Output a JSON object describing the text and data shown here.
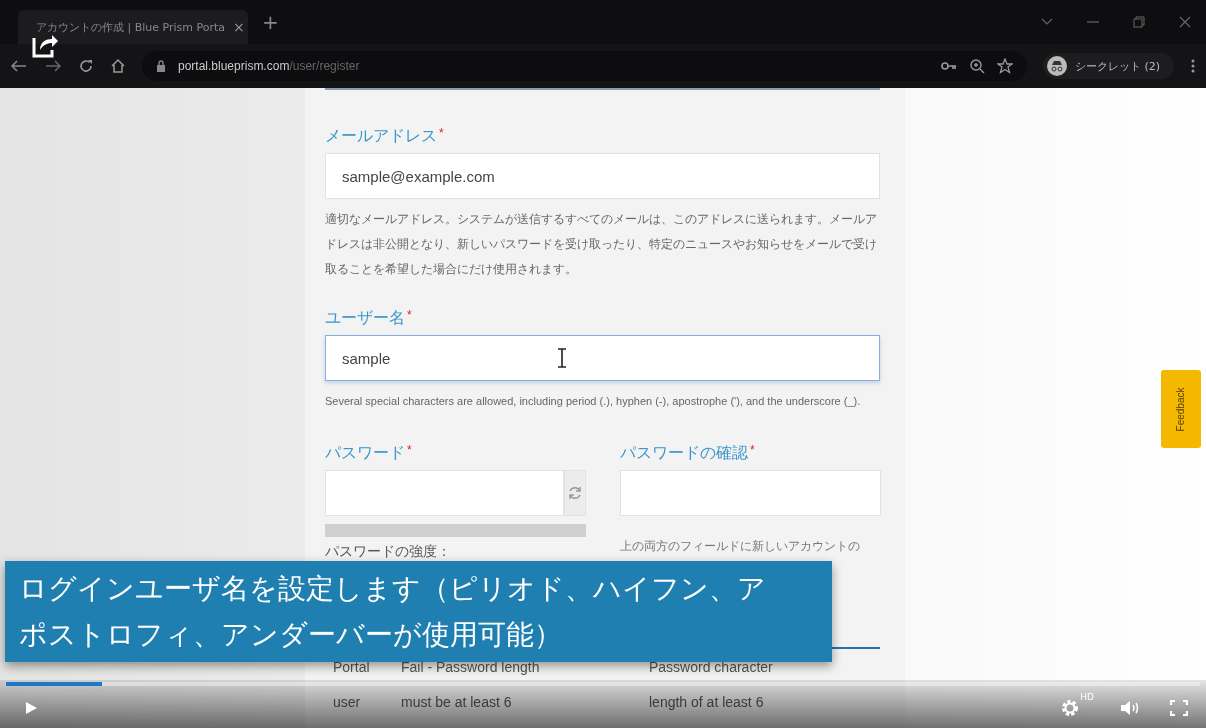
{
  "browser": {
    "tab": {
      "title": "アカウントの作成 | Blue Prism Porta",
      "close": "×"
    },
    "new_tab": "+",
    "url": {
      "host": "portal.blueprism.com",
      "path": "/user/register"
    },
    "incognito": "シークレット (2)"
  },
  "form": {
    "email": {
      "label": "メールアドレス",
      "required_mark": "*",
      "value": "sample@example.com",
      "help": "適切なメールアドレス。システムが送信するすべてのメールは、このアドレスに送られます。メールアドレスは非公開となり、新しいパスワードを受け取ったり、特定のニュースやお知らせをメールで受け取ることを希望した場合にだけ使用されます。"
    },
    "username": {
      "label": "ユーザー名",
      "required_mark": "*",
      "value": "sample",
      "focused": true,
      "help": "Several special characters are allowed, including period (.), hyphen (-), apostrophe ('), and the underscore (_)."
    },
    "password": {
      "label": "パスワード",
      "required_mark": "*"
    },
    "password_confirm": {
      "label": "パスワードの確認",
      "required_mark": "*"
    },
    "strength": {
      "level": 0,
      "label": "パスワードの強度："
    },
    "confirm_help": "上の両方のフィールドに新しいアカウントの",
    "table_rows": [
      [
        "Portal",
        "Fail - Password length",
        "Password character"
      ],
      [
        "user",
        "must be at least 6",
        "length of at least 6"
      ]
    ]
  },
  "feedback": "Feedback",
  "video": {
    "subtitle_lines": [
      "ログインユーザ名を設定します（ピリオド、ハイフン、ア",
      "ポストロフィ、アンダーバーが使用可能）"
    ],
    "progress": {
      "level": 0.08
    },
    "quality_badge": "HD"
  }
}
